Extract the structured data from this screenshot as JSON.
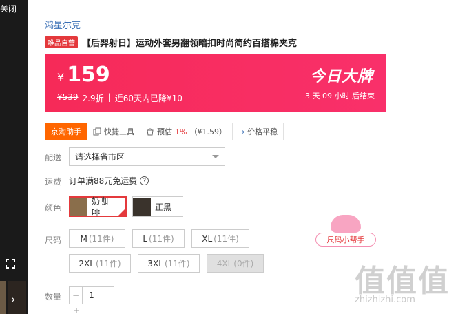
{
  "gallery": {
    "close_label": "关闭",
    "expand_icon": "fullscreen-icon",
    "next_icon": "chevron-right-icon"
  },
  "product": {
    "brand": "鸿星尔克",
    "self_badge": "唯品自营",
    "title": "【后羿射日】运动外套男翻领暗扣时尚简约百搭棉夹克"
  },
  "price_banner": {
    "currency": "¥",
    "price": "159",
    "original": "¥539",
    "discount": "2.9折",
    "separator": "|",
    "drop_note": "近60天内已降¥10",
    "deal_label": "今日大牌",
    "countdown": "3  天 09  小时 后结束",
    "colors": {
      "start": "#f62a58",
      "end": "#f9306a"
    }
  },
  "toolbar": {
    "items": [
      {
        "label": "京淘助手",
        "icon": ""
      },
      {
        "label": "快捷工具",
        "icon": "copy-icon"
      },
      {
        "label": "预估",
        "icon": "bag-icon",
        "rate": "1%",
        "amount": "（¥1.59）"
      },
      {
        "label": "价格平稳",
        "icon": "arrow-right-icon"
      }
    ]
  },
  "delivery": {
    "label": "配送",
    "placeholder": "请选择省市区"
  },
  "shipping": {
    "label": "运费",
    "text": "订单满88元免运费",
    "help_icon": "question-circle-icon"
  },
  "color": {
    "label": "颜色",
    "options": [
      {
        "name": "奶咖啡",
        "selected": true
      },
      {
        "name": "正黑",
        "selected": false
      }
    ]
  },
  "size": {
    "label": "尺码",
    "options": [
      {
        "name": "M",
        "count": "(11件)"
      },
      {
        "name": "L",
        "count": "(11件)"
      },
      {
        "name": "XL",
        "count": "(11件)"
      },
      {
        "name": "2XL",
        "count": "(11件)"
      },
      {
        "name": "3XL",
        "count": "(11件)"
      },
      {
        "name": "4XL",
        "count": "(0件)",
        "disabled": true
      }
    ],
    "helper": "尺码小帮手"
  },
  "quantity": {
    "label": "数量",
    "value": "1",
    "minus": "−",
    "plus": "+"
  },
  "watermark": {
    "main": "值值值",
    "sub": "zhizhizhi.com"
  }
}
